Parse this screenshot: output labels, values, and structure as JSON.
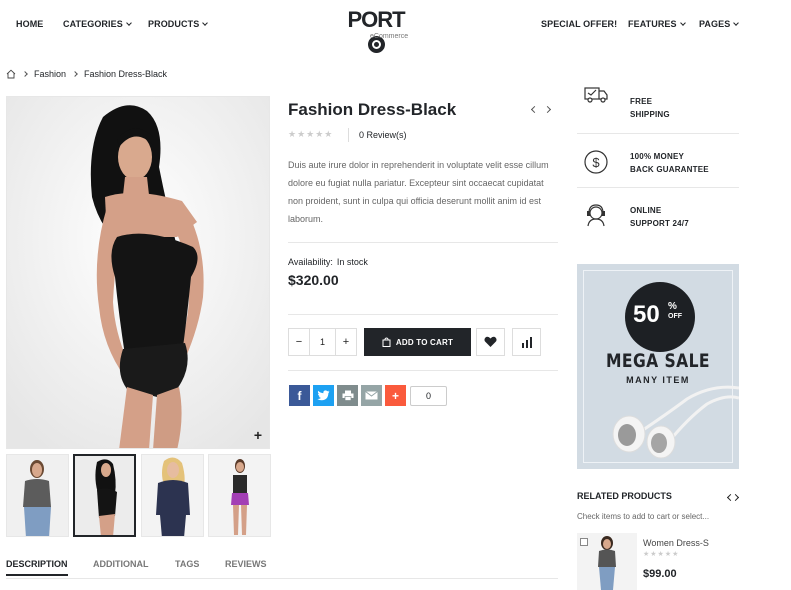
{
  "nav": {
    "left": [
      {
        "label": "HOME"
      },
      {
        "label": "CATEGORIES"
      },
      {
        "label": "PRODUCTS"
      }
    ],
    "right": [
      {
        "label": "SPECIAL OFFER!"
      },
      {
        "label": "FEATURES"
      },
      {
        "label": "PAGES"
      }
    ]
  },
  "logo": {
    "main_left": "PORT",
    "sub": "eCommerce"
  },
  "breadcrumb": {
    "items": [
      "Fashion",
      "Fashion Dress-Black"
    ]
  },
  "product": {
    "title": "Fashion Dress-Black",
    "rating_stars": "★★★★★",
    "reviews": "0 Review(s)",
    "description": "Duis aute irure dolor in reprehenderit in voluptate velit esse cillum dolore eu fugiat nulla pariatur. Excepteur sint occaecat cupidatat non proident, sunt in culpa qui officia deserunt mollit anim id est laborum.",
    "availability_label": "Availability:",
    "availability_value": "In stock",
    "price": "$320.00",
    "quantity": "1",
    "qty_minus": "−",
    "qty_plus": "+",
    "add_to_cart": "ADD TO CART",
    "share_count": "0"
  },
  "tabs": [
    "DESCRIPTION",
    "ADDITIONAL",
    "TAGS",
    "REVIEWS"
  ],
  "features": [
    {
      "line1": "FREE",
      "line2": "SHIPPING",
      "icon": "truck-icon"
    },
    {
      "line1": "100% MONEY",
      "line2": "BACK GUARANTEE",
      "icon": "dollar-icon"
    },
    {
      "line1": "ONLINE",
      "line2": "SUPPORT 24/7",
      "icon": "support-icon"
    }
  ],
  "banner": {
    "percent": "50",
    "percent_sign": "%",
    "off": "OFF",
    "title": "MEGA SALE",
    "subtitle": "MANY ITEM"
  },
  "related": {
    "title": "RELATED PRODUCTS",
    "subtitle": "Check items to add to cart or select...",
    "items": [
      {
        "name": "Women Dress-S",
        "stars": "★★★★★",
        "price": "$99.00"
      }
    ]
  },
  "colors": {
    "dark": "#222529",
    "facebook": "#3b5998",
    "twitter": "#1da1f2",
    "print": "#7f8c8d",
    "email": "#95a5a6",
    "plus": "#fa5a3c",
    "banner": "#d2dbe3"
  }
}
